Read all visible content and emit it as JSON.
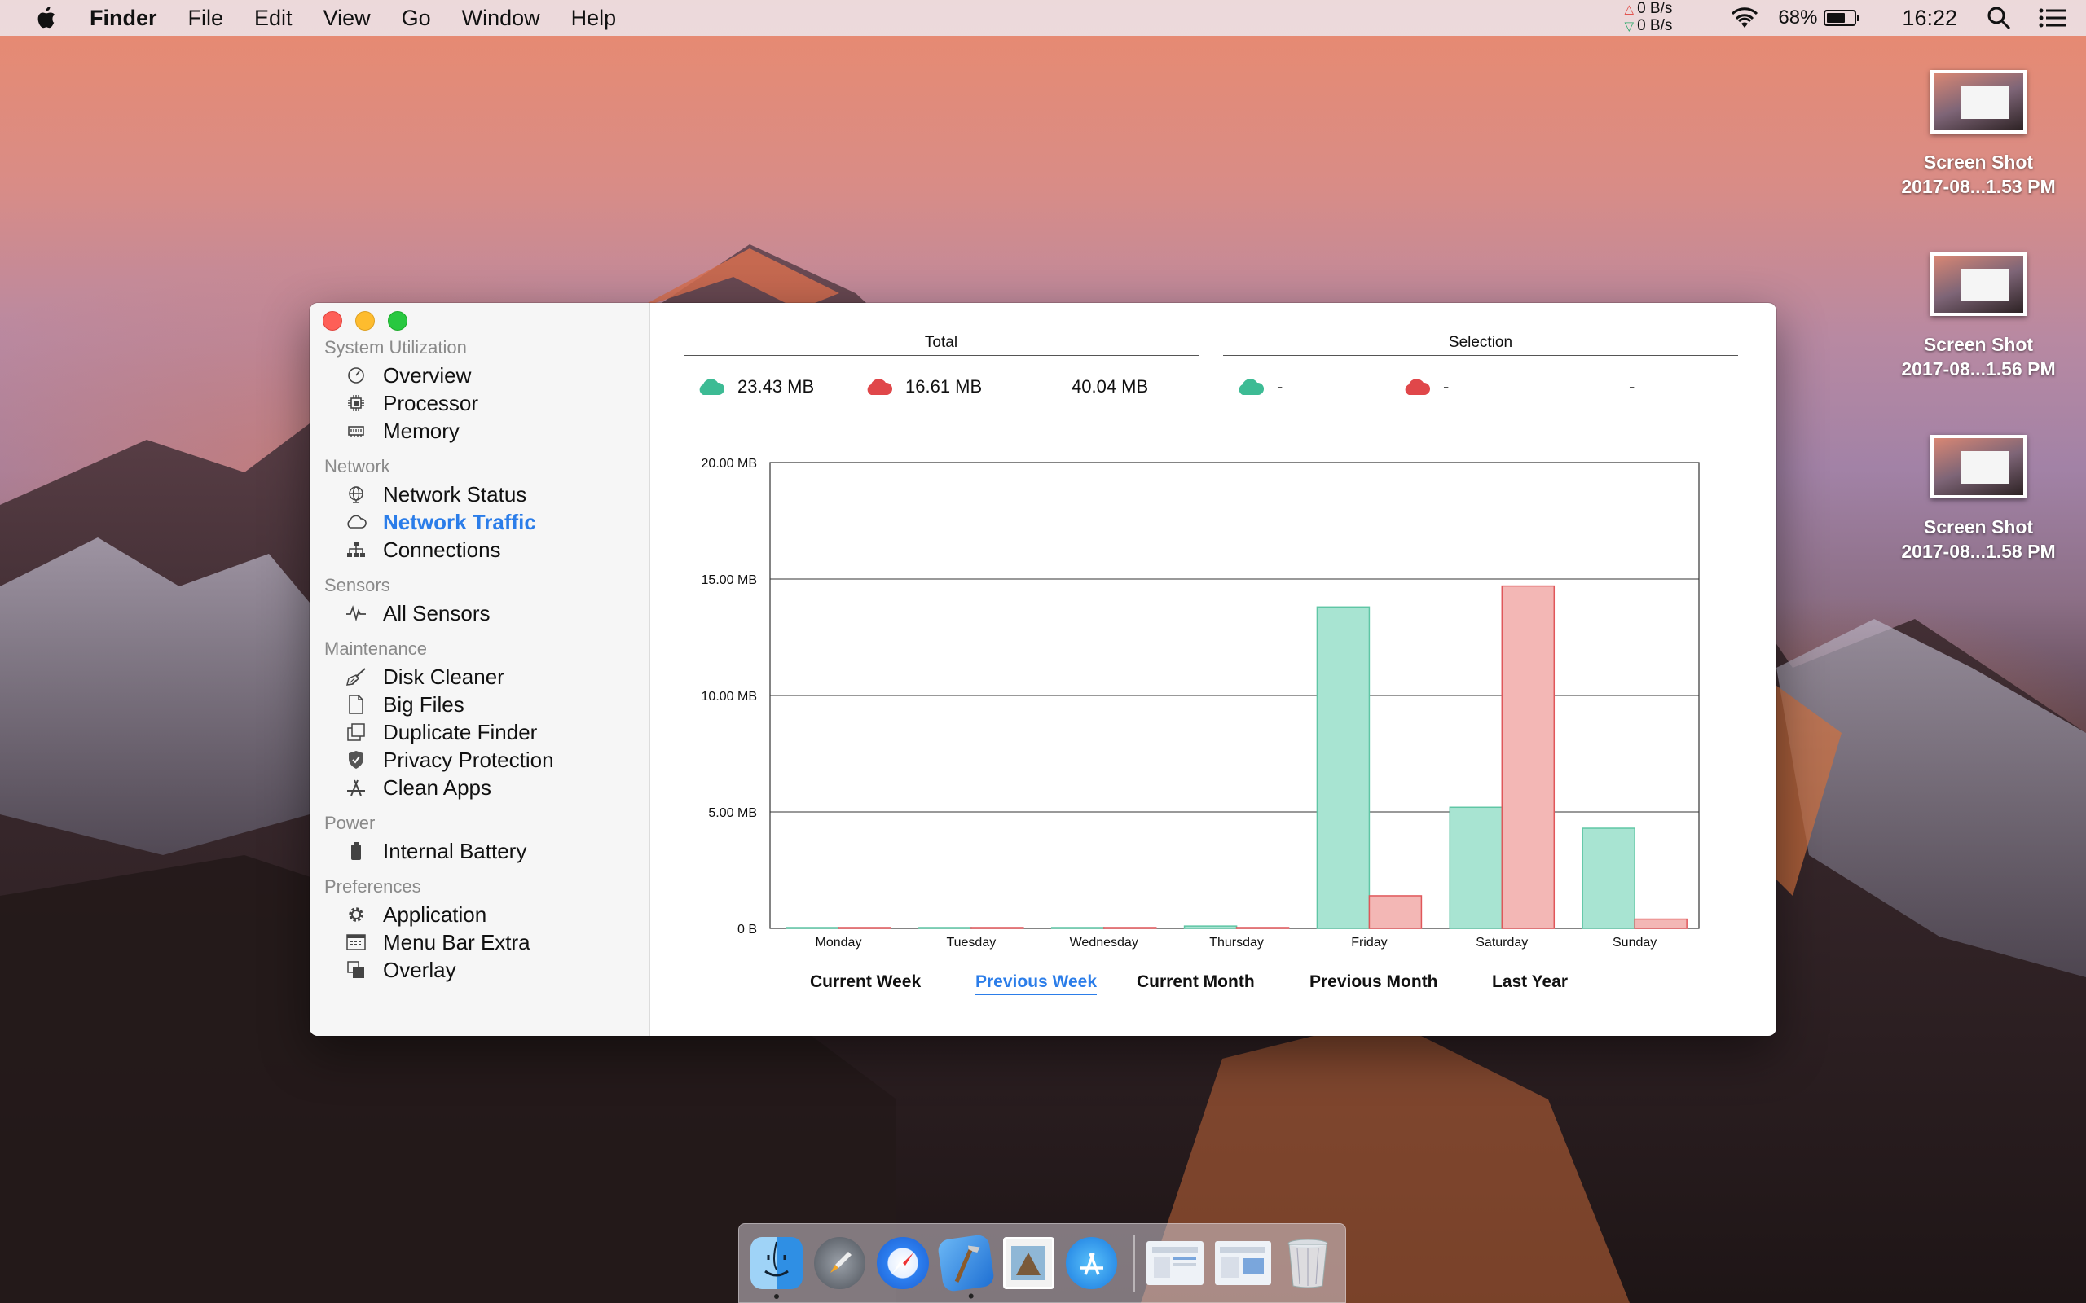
{
  "menubar": {
    "app_name": "Finder",
    "menus": [
      "File",
      "Edit",
      "View",
      "Go",
      "Window",
      "Help"
    ],
    "net_up": "0 B/s",
    "net_down": "0 B/s",
    "battery_percent": "68%",
    "battery_level": 0.68,
    "clock": "16:22"
  },
  "desktop_icons": [
    {
      "name_line1": "Screen Shot",
      "name_line2": "2017-08...1.53 PM"
    },
    {
      "name_line1": "Screen Shot",
      "name_line2": "2017-08...1.56 PM"
    },
    {
      "name_line1": "Screen Shot",
      "name_line2": "2017-08...1.58 PM"
    }
  ],
  "sidebar": {
    "sections": [
      {
        "title": "System Utilization",
        "items": [
          {
            "label": "Overview",
            "icon": "gauge-icon"
          },
          {
            "label": "Processor",
            "icon": "cpu-icon"
          },
          {
            "label": "Memory",
            "icon": "memory-icon"
          }
        ]
      },
      {
        "title": "Network",
        "items": [
          {
            "label": "Network Status",
            "icon": "globe-icon"
          },
          {
            "label": "Network Traffic",
            "icon": "cloud-icon",
            "active": true
          },
          {
            "label": "Connections",
            "icon": "hierarchy-icon"
          }
        ]
      },
      {
        "title": "Sensors",
        "items": [
          {
            "label": "All Sensors",
            "icon": "pulse-icon"
          }
        ]
      },
      {
        "title": "Maintenance",
        "items": [
          {
            "label": "Disk Cleaner",
            "icon": "broom-icon"
          },
          {
            "label": "Big Files",
            "icon": "file-icon"
          },
          {
            "label": "Duplicate Finder",
            "icon": "duplicate-icon"
          },
          {
            "label": "Privacy Protection",
            "icon": "shield-icon"
          },
          {
            "label": "Clean Apps",
            "icon": "app-store-icon"
          }
        ]
      },
      {
        "title": "Power",
        "items": [
          {
            "label": "Internal Battery",
            "icon": "battery-icon"
          }
        ]
      },
      {
        "title": "Preferences",
        "items": [
          {
            "label": "Application",
            "icon": "gear-icon"
          },
          {
            "label": "Menu Bar Extra",
            "icon": "calendar-icon"
          },
          {
            "label": "Overlay",
            "icon": "overlay-icon"
          }
        ]
      }
    ]
  },
  "summary": {
    "total_header": "Total",
    "selection_header": "Selection",
    "total_download": "23.43 MB",
    "total_upload": "16.61 MB",
    "total_sum": "40.04 MB",
    "selection_download": "-",
    "selection_upload": "-",
    "selection_sum": "-"
  },
  "colors": {
    "download": "#a8e4d2",
    "download_stroke": "#5fc6a5",
    "upload": "#f3b7b5",
    "upload_stroke": "#e0575a",
    "accent": "#2b7de9"
  },
  "chart_data": {
    "type": "bar",
    "categories": [
      "Monday",
      "Tuesday",
      "Wednesday",
      "Thursday",
      "Friday",
      "Saturday",
      "Sunday"
    ],
    "series": [
      {
        "values": [
          0,
          0,
          0,
          0.1,
          13.8,
          5.2,
          4.3
        ]
      },
      {
        "values": [
          0,
          0,
          0,
          0,
          1.4,
          14.7,
          0.4
        ]
      }
    ],
    "yticks": [
      0,
      5,
      10,
      15,
      20
    ],
    "ytick_labels": [
      "0 B",
      "5.00 MB",
      "10.00 MB",
      "15.00 MB",
      "20.00 MB"
    ],
    "ylim": [
      0,
      20
    ],
    "grid": true
  },
  "tabs": [
    {
      "label": "Current Week"
    },
    {
      "label": "Previous Week",
      "active": true
    },
    {
      "label": "Current Month"
    },
    {
      "label": "Previous Month"
    },
    {
      "label": "Last Year"
    }
  ],
  "dock": {
    "apps": [
      "finder-icon",
      "launchpad-icon",
      "safari-icon",
      "xcode-icon",
      "preview-icon",
      "app-store-icon"
    ],
    "docs": [
      "document-icon",
      "document-icon",
      "trash-icon"
    ]
  }
}
